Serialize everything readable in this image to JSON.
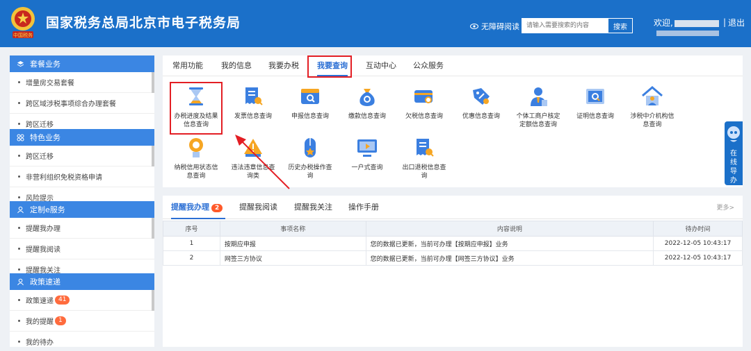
{
  "header": {
    "title": "国家税务总局北京市电子税务局",
    "seal_text": "中国税务",
    "accessibility": "无障碍阅读",
    "search_placeholder": "请输入需要搜索的内容",
    "search_button": "搜索",
    "welcome": "欢迎,",
    "separator": "|",
    "logout": "退出"
  },
  "sidebar": {
    "sections": [
      {
        "title": "套餐业务",
        "items": [
          "增量房交易套餐",
          "跨区域涉税事项综合办理套餐",
          "跨区迁移"
        ]
      },
      {
        "title": "特色业务",
        "items": [
          "跨区迁移",
          "非营利组织免税资格申请",
          "风险提示"
        ]
      },
      {
        "title": "定制e服务",
        "items": [
          "提醒我办理",
          "提醒我阅读",
          "提醒我关注"
        ]
      },
      {
        "title": "政策速递",
        "items": [
          "政策速递",
          "我的提醒",
          "我的待办"
        ]
      }
    ],
    "badges": {
      "policy": "41",
      "reminder": "1"
    }
  },
  "main_tabs": [
    "常用功能",
    "我的信息",
    "我要办税",
    "我要查询",
    "互动中心",
    "公众服务"
  ],
  "functions": [
    {
      "label1": "办税进度及结果",
      "label2": "信息查询",
      "icon": "hourglass-icon"
    },
    {
      "label1": "发票信息查询",
      "label2": "",
      "icon": "invoice-icon"
    },
    {
      "label1": "申报信息查询",
      "label2": "",
      "icon": "declaration-icon"
    },
    {
      "label1": "缴款信息查询",
      "label2": "",
      "icon": "moneybag-icon"
    },
    {
      "label1": "欠税信息查询",
      "label2": "",
      "icon": "card-icon"
    },
    {
      "label1": "优惠信息查询",
      "label2": "",
      "icon": "discount-tag-icon"
    },
    {
      "label1": "个体工商户核定",
      "label2": "定额信息查询",
      "icon": "person-icon"
    },
    {
      "label1": "证明信息查询",
      "label2": "",
      "icon": "certificate-icon"
    },
    {
      "label1": "涉税中介机构信",
      "label2": "息查询",
      "icon": "house-icon"
    },
    {
      "label1": "纳税信用状态信",
      "label2": "息查询",
      "icon": "medal-icon"
    },
    {
      "label1": "违法违章信息查",
      "label2": "询类",
      "icon": "warning-icon"
    },
    {
      "label1": "历史办税操作查",
      "label2": "询",
      "icon": "mouse-icon"
    },
    {
      "label1": "一户式查询",
      "label2": "",
      "icon": "monitor-icon"
    },
    {
      "label1": "出口退税信息查",
      "label2": "询",
      "icon": "export-doc-icon"
    }
  ],
  "help": {
    "label": "在线导办"
  },
  "bottom_tabs": {
    "items": [
      "提醒我办理",
      "提醒我阅读",
      "提醒我关注",
      "操作手册"
    ],
    "count": "2",
    "more": "更多>"
  },
  "table": {
    "headers": [
      "序号",
      "事项名称",
      "内容说明",
      "待办时间"
    ],
    "rows": [
      [
        "1",
        "按期应申报",
        "您的数据已更新，当前可办理【按期应申报】业务",
        "2022-12-05 10:43:17"
      ],
      [
        "2",
        "网签三方协议",
        "您的数据已更新，当前可办理【网签三方协议】业务",
        "2022-12-05 10:43:17"
      ]
    ]
  }
}
